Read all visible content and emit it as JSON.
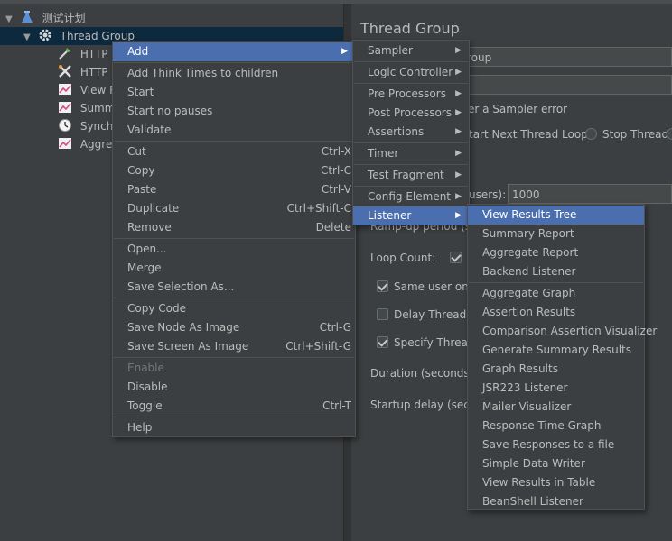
{
  "tree": {
    "root_label": "测试计划",
    "thread_group_label": "Thread Group",
    "children": [
      {
        "label": "HTTP R",
        "icon": "pipette-icon"
      },
      {
        "label": "HTTP H",
        "icon": "wrench-icon"
      },
      {
        "label": "View Re",
        "icon": "chart-icon"
      },
      {
        "label": "Summa",
        "icon": "chart-icon"
      },
      {
        "label": "Synchr",
        "icon": "timer-icon"
      },
      {
        "label": "Aggreg",
        "icon": "chart-icon"
      }
    ]
  },
  "right_panel": {
    "title": "Thread Group",
    "name_value": "roup",
    "sampler_error_label": "er a Sampler error",
    "start_next_loop_label": "tart Next Thread Loop",
    "stop_thread_label": "Stop Thread",
    "users_label": "users):",
    "users_value": "1000",
    "ramp_up_label": "Ramp-up period (sec",
    "loop_count_label": "Loop Count:",
    "same_user_label": "Same user on e",
    "delay_thread_label": "Delay Thread cr",
    "specify_thread_label": "Specify Thread",
    "duration_label": "Duration (seconds):",
    "startup_delay_label": "Startup delay (secon"
  },
  "context_menu": {
    "add": "Add",
    "add_think_times": "Add Think Times to children",
    "start": "Start",
    "start_no_pauses": "Start no pauses",
    "validate": "Validate",
    "cut": "Cut",
    "cut_sc": "Ctrl-X",
    "copy": "Copy",
    "copy_sc": "Ctrl-C",
    "paste": "Paste",
    "paste_sc": "Ctrl-V",
    "duplicate": "Duplicate",
    "duplicate_sc": "Ctrl+Shift-C",
    "remove": "Remove",
    "remove_sc": "Delete",
    "open": "Open...",
    "merge": "Merge",
    "save_selection": "Save Selection As...",
    "copy_code": "Copy Code",
    "save_node_image": "Save Node As Image",
    "save_node_image_sc": "Ctrl-G",
    "save_screen_image": "Save Screen As Image",
    "save_screen_image_sc": "Ctrl+Shift-G",
    "enable": "Enable",
    "disable": "Disable",
    "toggle": "Toggle",
    "toggle_sc": "Ctrl-T",
    "help": "Help"
  },
  "add_submenu": {
    "sampler": "Sampler",
    "logic_controller": "Logic Controller",
    "pre_processors": "Pre Processors",
    "post_processors": "Post Processors",
    "assertions": "Assertions",
    "timer": "Timer",
    "test_fragment": "Test Fragment",
    "config_element": "Config Element",
    "listener": "Listener"
  },
  "listener_submenu": [
    "View Results Tree",
    "Summary Report",
    "Aggregate Report",
    "Backend Listener",
    "Aggregate Graph",
    "Assertion Results",
    "Comparison Assertion Visualizer",
    "Generate Summary Results",
    "Graph Results",
    "JSR223 Listener",
    "Mailer Visualizer",
    "Response Time Graph",
    "Save Responses to a file",
    "Simple Data Writer",
    "View Results in Table",
    "BeanShell Listener"
  ],
  "colors": {
    "background": "#3c3f41",
    "highlight": "#4b6eaf",
    "tree_selected": "#0d293e",
    "text": "#bbbbbb"
  }
}
